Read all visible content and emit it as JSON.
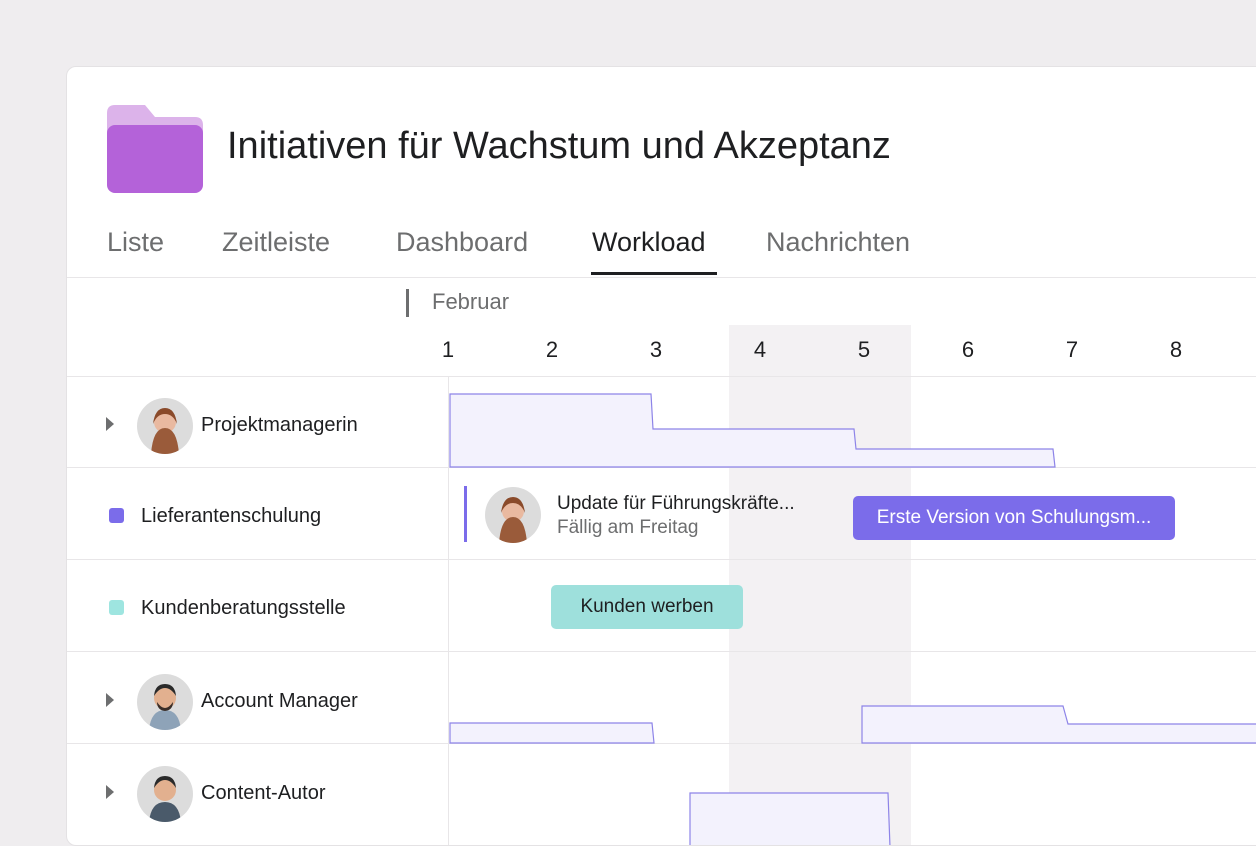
{
  "project": {
    "title": "Initiativen für Wachstum und Akzeptanz",
    "icon": "folder-icon",
    "color": "#b462d9"
  },
  "tabs": [
    {
      "label": "Liste"
    },
    {
      "label": "Zeitleiste"
    },
    {
      "label": "Dashboard"
    },
    {
      "label": "Workload",
      "active": true
    },
    {
      "label": "Nachrichten"
    }
  ],
  "timeline": {
    "month": "Februar",
    "days": [
      "1",
      "2",
      "3",
      "4",
      "5",
      "6",
      "7",
      "8"
    ],
    "highlighted_days": [
      "4",
      "5"
    ]
  },
  "rows": [
    {
      "label": "Projektmanagerin",
      "type": "person",
      "expandable": true
    },
    {
      "label": "Lieferantenschulung",
      "type": "project",
      "color": "#7b6cea"
    },
    {
      "label": "Kundenberatungsstelle",
      "type": "project",
      "color": "#9ee5e0"
    },
    {
      "label": "Account Manager",
      "type": "person",
      "expandable": true
    },
    {
      "label": "Content-Autor",
      "type": "person",
      "expandable": true
    }
  ],
  "tasks": {
    "update": {
      "title": "Update für Führungskräfte...",
      "due": "Fällig am Freitag"
    },
    "erste_version": {
      "label": "Erste Version von Schulungsm...",
      "color": "#7b6cea"
    },
    "kunden_werben": {
      "label": "Kunden werben",
      "color": "#9ee0dc"
    }
  },
  "colors": {
    "workload_fill": "#f3f2fd",
    "workload_stroke": "#8d84e8"
  }
}
